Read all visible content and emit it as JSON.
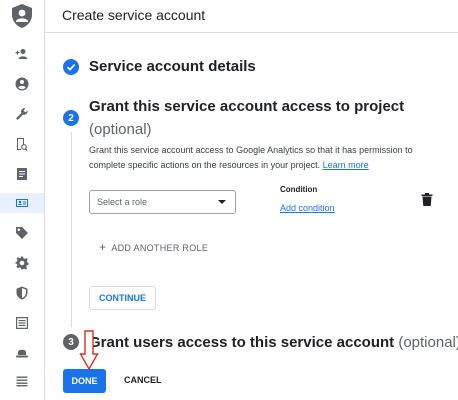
{
  "app": {
    "title": "Create service account",
    "colors": {
      "accent": "#1a73e8",
      "step_done": "#1a73e8",
      "step_pending": "#5f6368",
      "annotation_arrow": "#d93025"
    }
  },
  "sidebar": {
    "items": [
      {
        "icon": "add-person-icon"
      },
      {
        "icon": "account-circle-icon"
      },
      {
        "icon": "wrench-icon"
      },
      {
        "icon": "audit-doc-icon"
      },
      {
        "icon": "document-icon"
      },
      {
        "icon": "service-account-icon",
        "active": true
      },
      {
        "icon": "tag-icon"
      },
      {
        "icon": "gear-icon"
      },
      {
        "icon": "shield-icon"
      },
      {
        "icon": "list-frame-icon"
      },
      {
        "icon": "hat-icon"
      },
      {
        "icon": "menu-lines-icon"
      }
    ]
  },
  "steps": {
    "step1": {
      "title": "Service account details",
      "status": "done"
    },
    "step2": {
      "number": "2",
      "title": "Grant this service account access to project",
      "optional": "(optional)",
      "description": "Grant this service account access to Google Analytics so that it has permission to complete specific actions on the resources in your project.",
      "learn_more": "Learn more",
      "role_placeholder": "Select a role",
      "condition_label": "Condition",
      "add_condition": "Add condition",
      "add_role": "ADD ANOTHER ROLE",
      "continue": "CONTINUE"
    },
    "step3": {
      "number": "3",
      "title": "Grant users access to this service account",
      "optional": "(optional)"
    }
  },
  "footer": {
    "done": "DONE",
    "cancel": "CANCEL"
  }
}
